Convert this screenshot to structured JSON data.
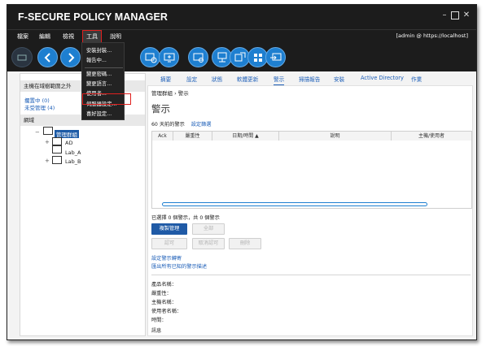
{
  "app": {
    "title": "F-SECURE POLICY MANAGER",
    "window_controls": {
      "minimize": "–",
      "maximize": "□",
      "close": "✕"
    }
  },
  "menubar": {
    "items": [
      {
        "label": "檔案"
      },
      {
        "label": "編輯"
      },
      {
        "label": "檢視"
      },
      {
        "label": "工具"
      },
      {
        "label": "說明"
      }
    ],
    "user": "[admin @ https://localhost]"
  },
  "toolbar": {
    "icons": [
      "back-icon",
      "back-circle-icon",
      "forward-circle-icon",
      "policy-icon",
      "computer-icon",
      "settings-computer-icon",
      "network-icon",
      "deploy-icon",
      "windows-icon",
      "import-icon"
    ]
  },
  "tools_menu": {
    "items": [
      {
        "label": "安裝封裝..."
      },
      {
        "label": "報告中..."
      },
      {
        "label": "變更密碼..."
      },
      {
        "label": "變更語言..."
      },
      {
        "label": "使用者..."
      },
      {
        "label": "伺服器設定..."
      },
      {
        "label": "喜好設定..."
      }
    ],
    "highlighted": "伺服器設定..."
  },
  "left_panel": {
    "header": "主機在域樹範圍之外",
    "links": [
      {
        "label": "擱置中 (0)"
      },
      {
        "label": "未受管理 (4)"
      }
    ],
    "tree_header": "網域",
    "tree": {
      "root": "管理群組",
      "children": [
        "AD",
        "Lab_A",
        "Lab_B"
      ]
    }
  },
  "tabs": [
    {
      "label": "摘要"
    },
    {
      "label": "設定"
    },
    {
      "label": "狀態"
    },
    {
      "label": "軟體更新"
    },
    {
      "label": "警示"
    },
    {
      "label": "掃描報告"
    },
    {
      "label": "安裝"
    },
    {
      "label": "Active Directory"
    },
    {
      "label": "作業"
    }
  ],
  "main": {
    "breadcrumb": "管理群組 › 警示",
    "title": "警示",
    "filter_text": "60 天前的警示",
    "filter_link": "設定篩選",
    "table": {
      "columns": [
        "Ack",
        "嚴重性",
        "日期/時間 ▲",
        "說明",
        "主機/使用者"
      ]
    },
    "summary": "已選擇 0 個警示，共 0 個警示",
    "buttons": {
      "manage": "複製管理",
      "all": "全部",
      "ack": "認可",
      "unack": "取消認可",
      "delete": "刪除"
    },
    "links": {
      "forwarding": "設定警示轉寄",
      "export": "匯出所有已知的警示描述"
    },
    "details": {
      "product": "產品名稱：",
      "severity": "嚴重性：",
      "host": "主機名稱：",
      "user": "使用者名稱：",
      "time": "時間：",
      "message": "訊息"
    }
  }
}
